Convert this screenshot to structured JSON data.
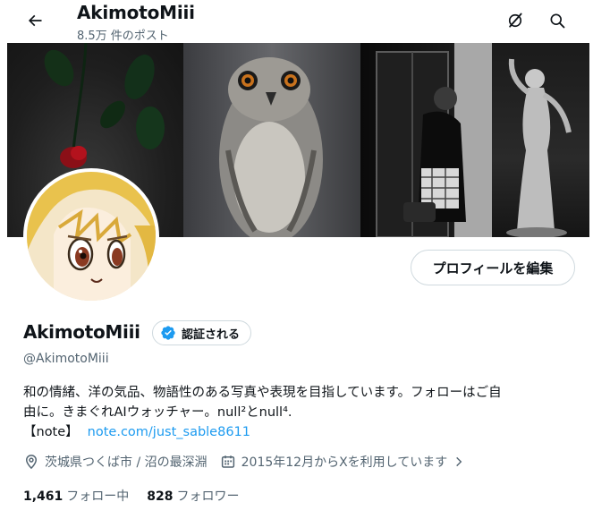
{
  "header": {
    "title": "AkimotoMiii",
    "post_count": "8.5万 件のポスト"
  },
  "profile": {
    "display_name": "AkimotoMiii",
    "verify_label": "認証される",
    "handle": "@AkimotoMiii",
    "edit_label": "プロフィールを編集",
    "bio_line1": "和の情緒、洋の気品、物語性のある写真や表現を目指しています。フォローはご自",
    "bio_line2": "由に。きまぐれAIウォッチャー。null²とnull⁴.",
    "note_label": "【note】",
    "note_link": "note.com/just_sable8611",
    "location": "茨城県つくば市 / 沼の最深淵",
    "joined": "2015年12月からXを利用しています",
    "following_count": "1,461",
    "following_label": "フォロー中",
    "followers_count": "828",
    "followers_label": "フォロワー"
  },
  "colors": {
    "link": "#1d9bf0",
    "verified_badge": "#1d9bf0",
    "secondary_text": "#536471",
    "border": "#cfd9de"
  },
  "icons": [
    "back-arrow-icon",
    "grok-icon",
    "search-icon",
    "verified-badge-icon",
    "location-icon",
    "calendar-icon",
    "chevron-right-icon"
  ]
}
